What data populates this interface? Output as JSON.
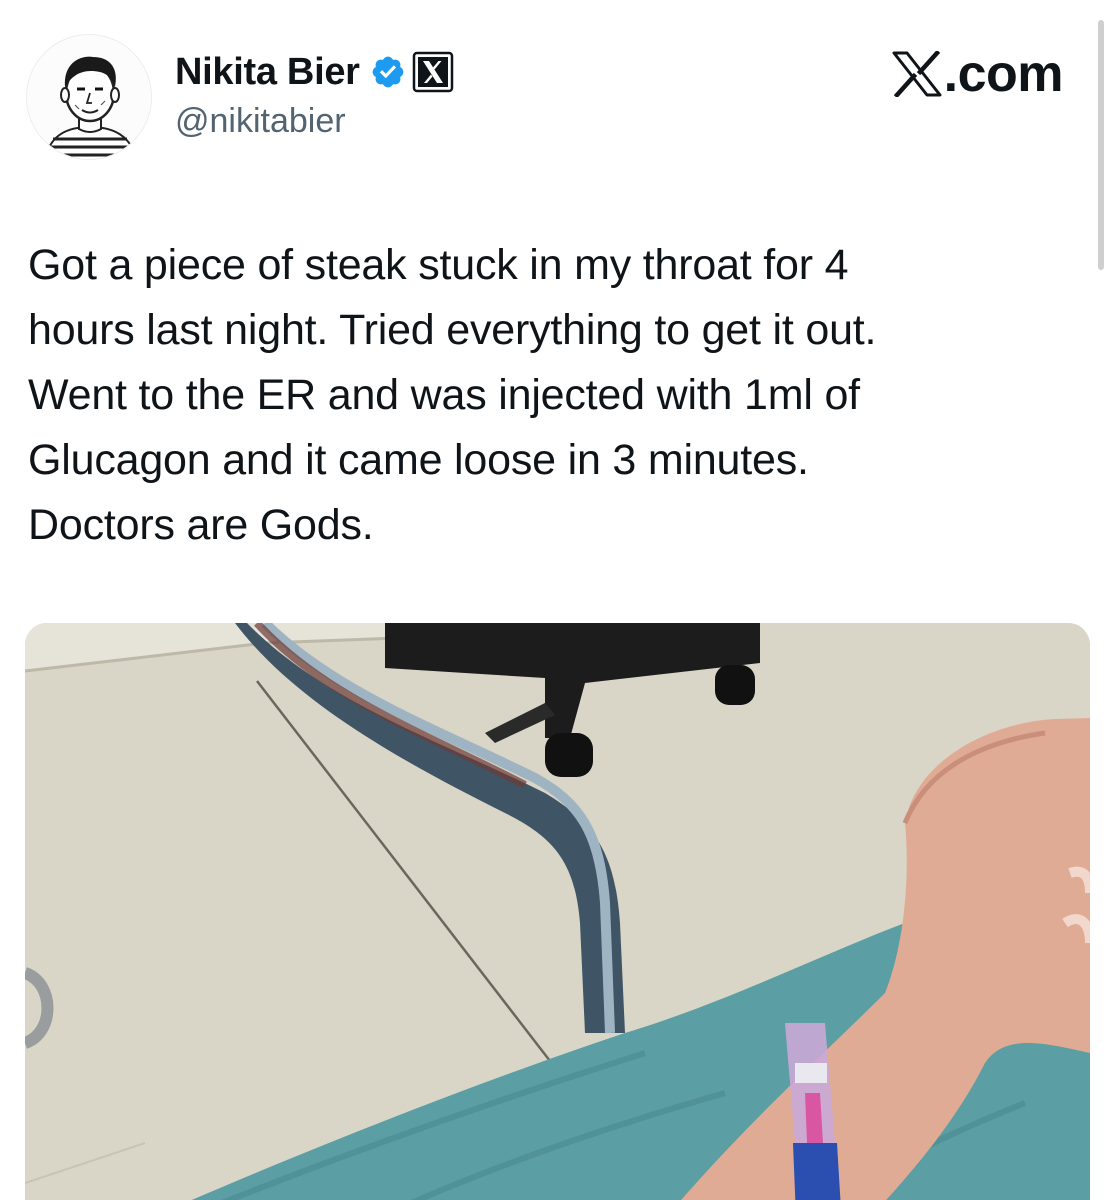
{
  "author": {
    "display_name": "Nikita Bier",
    "handle": "@nikitabier",
    "avatar": "sketch-portrait-avatar",
    "badges": [
      "verified-badge-icon",
      "x-affiliate-icon"
    ],
    "badge_color": "#1d9bf0"
  },
  "brand": {
    "label": ".com",
    "icon": "x-logo-icon"
  },
  "tweet": {
    "text": "Got a piece of steak stuck in my throat for 4\nhours last night. Tried everything to get it out.\nWent to the ER and was injected with 1ml of\nGlucagon and it came loose in 3 minutes.\nDoctors are Gods."
  },
  "media": {
    "type": "photo",
    "icon": "photo-attachment"
  },
  "colors": {
    "text": "#0f1419",
    "secondary_text": "#536471",
    "verified": "#1d9bf0",
    "background": "#ffffff"
  }
}
